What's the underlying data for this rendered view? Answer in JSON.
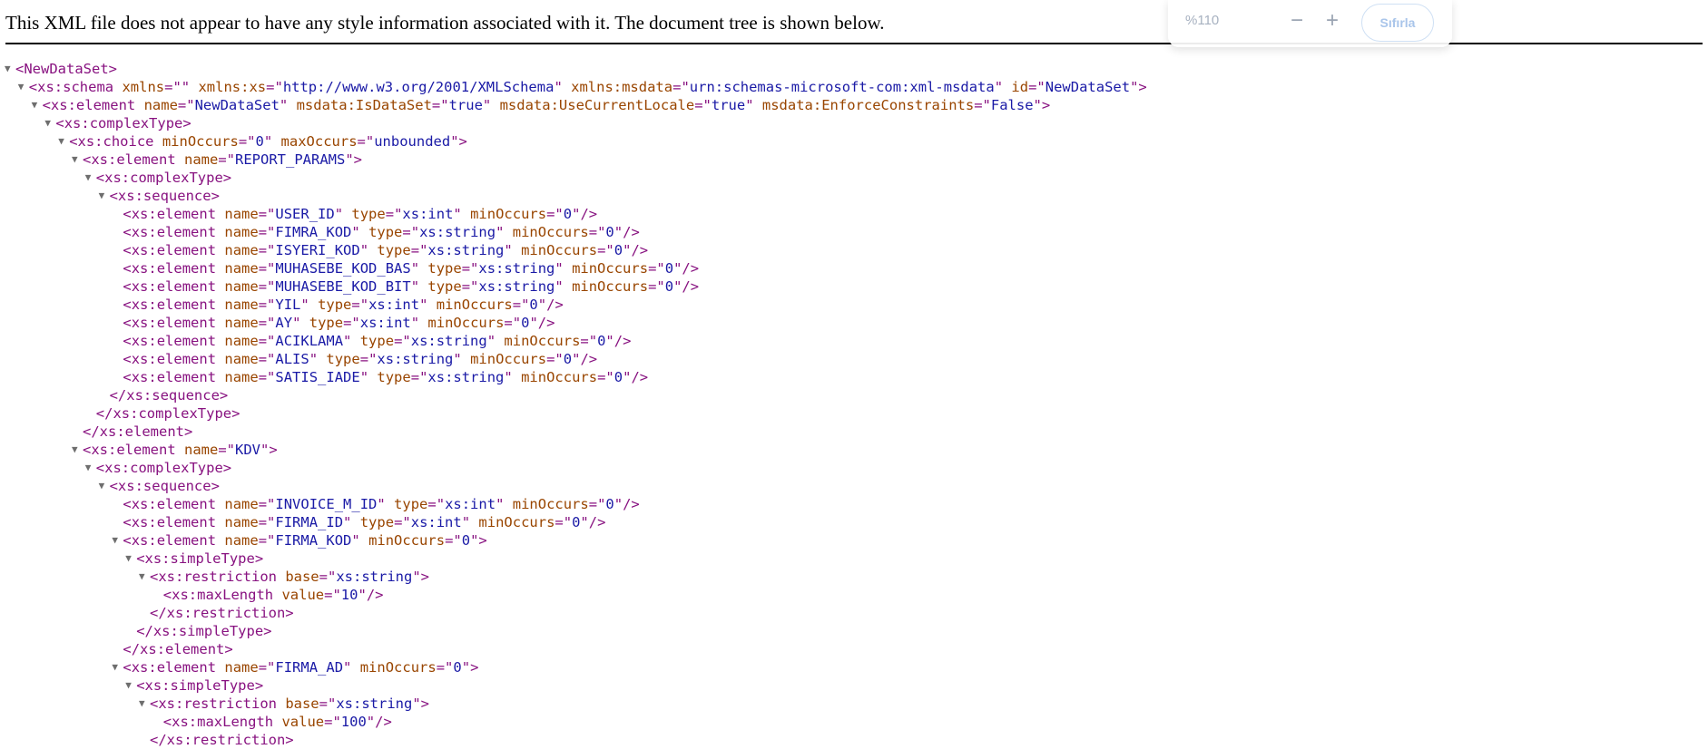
{
  "header": {
    "notice": "This XML file does not appear to have any style information associated with it. The document tree is shown below."
  },
  "zoom": {
    "level": "%110",
    "zoom_out_label": "−",
    "zoom_in_label": "+",
    "reset_label": "Sıfırla"
  },
  "tree": {
    "toggle_glyph": "▼",
    "lines": [
      {
        "depth": 0,
        "toggle": true,
        "kind": "open",
        "tag": "NewDataSet",
        "attrs": []
      },
      {
        "depth": 1,
        "toggle": true,
        "kind": "open",
        "tag": "xs:schema",
        "attrs": [
          [
            "xmlns",
            ""
          ],
          [
            "xmlns:xs",
            "http://www.w3.org/2001/XMLSchema"
          ],
          [
            "xmlns:msdata",
            "urn:schemas-microsoft-com:xml-msdata"
          ],
          [
            "id",
            "NewDataSet"
          ]
        ]
      },
      {
        "depth": 2,
        "toggle": true,
        "kind": "open",
        "tag": "xs:element",
        "attrs": [
          [
            "name",
            "NewDataSet"
          ],
          [
            "msdata:IsDataSet",
            "true"
          ],
          [
            "msdata:UseCurrentLocale",
            "true"
          ],
          [
            "msdata:EnforceConstraints",
            "False"
          ]
        ]
      },
      {
        "depth": 3,
        "toggle": true,
        "kind": "open",
        "tag": "xs:complexType",
        "attrs": []
      },
      {
        "depth": 4,
        "toggle": true,
        "kind": "open",
        "tag": "xs:choice",
        "attrs": [
          [
            "minOccurs",
            "0"
          ],
          [
            "maxOccurs",
            "unbounded"
          ]
        ]
      },
      {
        "depth": 5,
        "toggle": true,
        "kind": "open",
        "tag": "xs:element",
        "attrs": [
          [
            "name",
            "REPORT_PARAMS"
          ]
        ]
      },
      {
        "depth": 6,
        "toggle": true,
        "kind": "open",
        "tag": "xs:complexType",
        "attrs": []
      },
      {
        "depth": 7,
        "toggle": true,
        "kind": "open",
        "tag": "xs:sequence",
        "attrs": []
      },
      {
        "depth": 8,
        "toggle": false,
        "kind": "empty",
        "tag": "xs:element",
        "attrs": [
          [
            "name",
            "USER_ID"
          ],
          [
            "type",
            "xs:int"
          ],
          [
            "minOccurs",
            "0"
          ]
        ]
      },
      {
        "depth": 8,
        "toggle": false,
        "kind": "empty",
        "tag": "xs:element",
        "attrs": [
          [
            "name",
            "FIMRA_KOD"
          ],
          [
            "type",
            "xs:string"
          ],
          [
            "minOccurs",
            "0"
          ]
        ]
      },
      {
        "depth": 8,
        "toggle": false,
        "kind": "empty",
        "tag": "xs:element",
        "attrs": [
          [
            "name",
            "ISYERI_KOD"
          ],
          [
            "type",
            "xs:string"
          ],
          [
            "minOccurs",
            "0"
          ]
        ]
      },
      {
        "depth": 8,
        "toggle": false,
        "kind": "empty",
        "tag": "xs:element",
        "attrs": [
          [
            "name",
            "MUHASEBE_KOD_BAS"
          ],
          [
            "type",
            "xs:string"
          ],
          [
            "minOccurs",
            "0"
          ]
        ]
      },
      {
        "depth": 8,
        "toggle": false,
        "kind": "empty",
        "tag": "xs:element",
        "attrs": [
          [
            "name",
            "MUHASEBE_KOD_BIT"
          ],
          [
            "type",
            "xs:string"
          ],
          [
            "minOccurs",
            "0"
          ]
        ]
      },
      {
        "depth": 8,
        "toggle": false,
        "kind": "empty",
        "tag": "xs:element",
        "attrs": [
          [
            "name",
            "YIL"
          ],
          [
            "type",
            "xs:int"
          ],
          [
            "minOccurs",
            "0"
          ]
        ]
      },
      {
        "depth": 8,
        "toggle": false,
        "kind": "empty",
        "tag": "xs:element",
        "attrs": [
          [
            "name",
            "AY"
          ],
          [
            "type",
            "xs:int"
          ],
          [
            "minOccurs",
            "0"
          ]
        ]
      },
      {
        "depth": 8,
        "toggle": false,
        "kind": "empty",
        "tag": "xs:element",
        "attrs": [
          [
            "name",
            "ACIKLAMA"
          ],
          [
            "type",
            "xs:string"
          ],
          [
            "minOccurs",
            "0"
          ]
        ]
      },
      {
        "depth": 8,
        "toggle": false,
        "kind": "empty",
        "tag": "xs:element",
        "attrs": [
          [
            "name",
            "ALIS"
          ],
          [
            "type",
            "xs:string"
          ],
          [
            "minOccurs",
            "0"
          ]
        ]
      },
      {
        "depth": 8,
        "toggle": false,
        "kind": "empty",
        "tag": "xs:element",
        "attrs": [
          [
            "name",
            "SATIS_IADE"
          ],
          [
            "type",
            "xs:string"
          ],
          [
            "minOccurs",
            "0"
          ]
        ]
      },
      {
        "depth": 7,
        "toggle": false,
        "kind": "close",
        "tag": "xs:sequence",
        "attrs": []
      },
      {
        "depth": 6,
        "toggle": false,
        "kind": "close",
        "tag": "xs:complexType",
        "attrs": []
      },
      {
        "depth": 5,
        "toggle": false,
        "kind": "close",
        "tag": "xs:element",
        "attrs": []
      },
      {
        "depth": 5,
        "toggle": true,
        "kind": "open",
        "tag": "xs:element",
        "attrs": [
          [
            "name",
            "KDV"
          ]
        ]
      },
      {
        "depth": 6,
        "toggle": true,
        "kind": "open",
        "tag": "xs:complexType",
        "attrs": []
      },
      {
        "depth": 7,
        "toggle": true,
        "kind": "open",
        "tag": "xs:sequence",
        "attrs": []
      },
      {
        "depth": 8,
        "toggle": false,
        "kind": "empty",
        "tag": "xs:element",
        "attrs": [
          [
            "name",
            "INVOICE_M_ID"
          ],
          [
            "type",
            "xs:int"
          ],
          [
            "minOccurs",
            "0"
          ]
        ]
      },
      {
        "depth": 8,
        "toggle": false,
        "kind": "empty",
        "tag": "xs:element",
        "attrs": [
          [
            "name",
            "FIRMA_ID"
          ],
          [
            "type",
            "xs:int"
          ],
          [
            "minOccurs",
            "0"
          ]
        ]
      },
      {
        "depth": 8,
        "toggle": true,
        "kind": "open",
        "tag": "xs:element",
        "attrs": [
          [
            "name",
            "FIRMA_KOD"
          ],
          [
            "minOccurs",
            "0"
          ]
        ]
      },
      {
        "depth": 9,
        "toggle": true,
        "kind": "open",
        "tag": "xs:simpleType",
        "attrs": []
      },
      {
        "depth": 10,
        "toggle": true,
        "kind": "open",
        "tag": "xs:restriction",
        "attrs": [
          [
            "base",
            "xs:string"
          ]
        ]
      },
      {
        "depth": 11,
        "toggle": false,
        "kind": "empty",
        "tag": "xs:maxLength",
        "attrs": [
          [
            "value",
            "10"
          ]
        ]
      },
      {
        "depth": 10,
        "toggle": false,
        "kind": "close",
        "tag": "xs:restriction",
        "attrs": []
      },
      {
        "depth": 9,
        "toggle": false,
        "kind": "close",
        "tag": "xs:simpleType",
        "attrs": []
      },
      {
        "depth": 8,
        "toggle": false,
        "kind": "close",
        "tag": "xs:element",
        "attrs": []
      },
      {
        "depth": 8,
        "toggle": true,
        "kind": "open",
        "tag": "xs:element",
        "attrs": [
          [
            "name",
            "FIRMA_AD"
          ],
          [
            "minOccurs",
            "0"
          ]
        ]
      },
      {
        "depth": 9,
        "toggle": true,
        "kind": "open",
        "tag": "xs:simpleType",
        "attrs": []
      },
      {
        "depth": 10,
        "toggle": true,
        "kind": "open",
        "tag": "xs:restriction",
        "attrs": [
          [
            "base",
            "xs:string"
          ]
        ]
      },
      {
        "depth": 11,
        "toggle": false,
        "kind": "empty",
        "tag": "xs:maxLength",
        "attrs": [
          [
            "value",
            "100"
          ]
        ]
      },
      {
        "depth": 10,
        "toggle": false,
        "kind": "close",
        "tag": "xs:restriction",
        "attrs": []
      }
    ]
  }
}
